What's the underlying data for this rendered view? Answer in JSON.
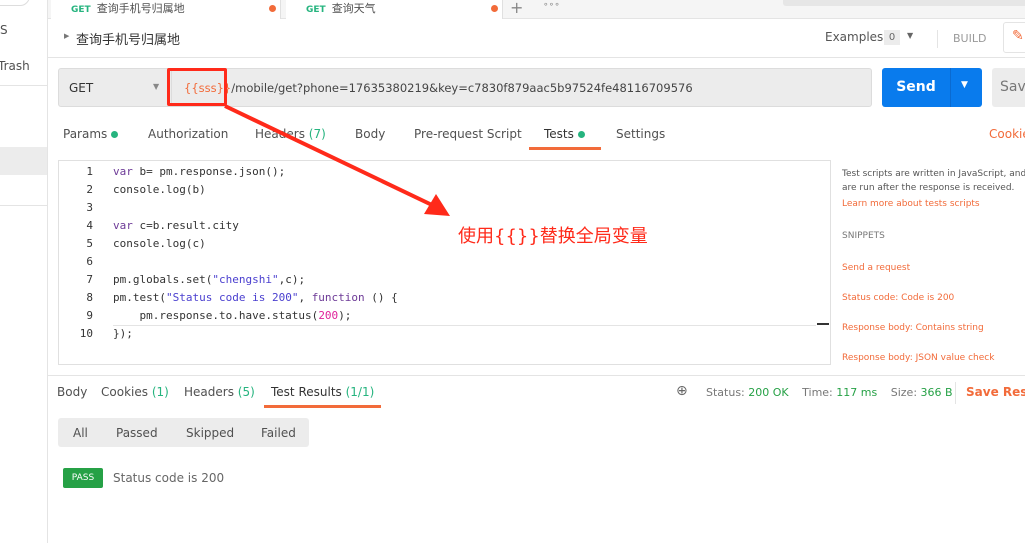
{
  "sidebar": {
    "item1": "S",
    "item2": "Trash"
  },
  "tabs": [
    {
      "method": "GET",
      "label": "查询手机号归属地"
    },
    {
      "method": "GET",
      "label": "查询天气"
    }
  ],
  "tab_add": "+",
  "tab_more": "∘∘∘",
  "request": {
    "title": "查询手机号归属地",
    "examples_label": "Examples",
    "examples_count": "0",
    "build_label": "BUILD",
    "method": "GET",
    "url_var": "{{sss}}",
    "url_rest": "/mobile/get?phone=17635380219&key=c7830f879aac5b97524fe48116709576",
    "send_label": "Send",
    "save_label": "Save"
  },
  "req_tabs": [
    {
      "label": "Params"
    },
    {
      "label": "Authorization"
    },
    {
      "label": "Headers",
      "count": "(7)"
    },
    {
      "label": "Body"
    },
    {
      "label": "Pre-request Script"
    },
    {
      "label": "Tests"
    },
    {
      "label": "Settings"
    }
  ],
  "cookies_label": "Cookies",
  "code_lines": [
    "1",
    "2",
    "3",
    "4",
    "5",
    "6",
    "7",
    "8",
    "9",
    "10"
  ],
  "snippets": {
    "intro": "Test scripts are written in JavaScript, and are run after the response is received.",
    "learn_more": "Learn more about tests scripts",
    "heading": "SNIPPETS",
    "items": [
      "Send a request",
      "Status code: Code is 200",
      "Response body: Contains string",
      "Response body: JSON value check"
    ]
  },
  "annotation": "使用{{}}替换全局变量",
  "resp_tabs": [
    {
      "label": "Body"
    },
    {
      "label": "Cookies",
      "count": "(1)"
    },
    {
      "label": "Headers",
      "count": "(5)"
    },
    {
      "label": "Test Results",
      "count": "(1/1)"
    }
  ],
  "status": {
    "status_label": "Status:",
    "status_value": "200 OK",
    "time_label": "Time:",
    "time_value": "117 ms",
    "size_label": "Size:",
    "size_value": "366 B",
    "save_response": "Save Response"
  },
  "filters": [
    "All",
    "Passed",
    "Skipped",
    "Failed"
  ],
  "result": {
    "badge": "PASS",
    "name": "Status code is 200"
  },
  "colors": {
    "accent": "#f26b3a",
    "send": "#097bed",
    "pass": "#26a146",
    "annotation": "#ff2a1a"
  }
}
